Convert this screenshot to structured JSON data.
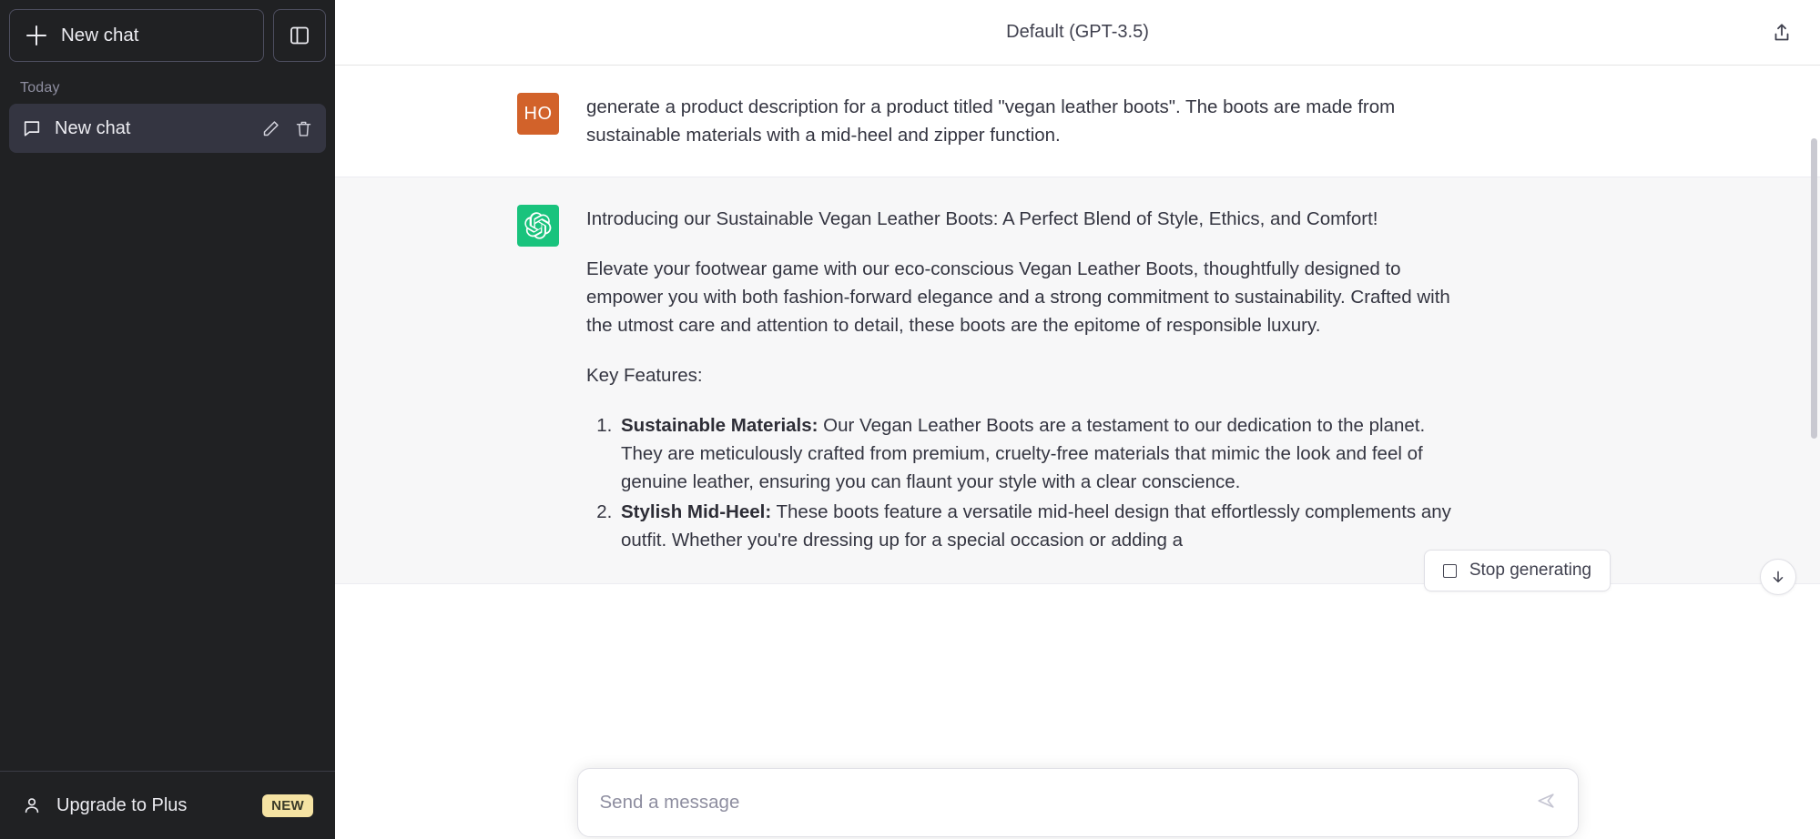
{
  "sidebar": {
    "new_chat_label": "New chat",
    "new_chat_icon": "plus-icon",
    "collapse_icon": "sidebar-collapse-icon",
    "section_label": "Today",
    "chats": [
      {
        "title": "New chat",
        "icon": "chat-bubble-icon",
        "edit_icon": "pencil-icon",
        "delete_icon": "trash-icon",
        "active": true
      }
    ],
    "upgrade": {
      "label": "Upgrade to Plus",
      "icon": "person-icon",
      "badge": "NEW",
      "badge_color": "#f5e3a3"
    }
  },
  "header": {
    "title": "Default (GPT-3.5)",
    "share_icon": "share-upload-icon"
  },
  "messages": [
    {
      "role": "user",
      "avatar_initials": "HO",
      "avatar_color": "#d2622a",
      "paragraphs": [
        "generate a product description for a product titled \"vegan leather boots\". The boots are made from sustainable materials with a mid-heel and zipper function."
      ]
    },
    {
      "role": "assistant",
      "avatar_icon": "chatgpt-logo-icon",
      "avatar_color": "#19c37d",
      "paragraphs": [
        "Introducing our Sustainable Vegan Leather Boots: A Perfect Blend of Style, Ethics, and Comfort!",
        "Elevate your footwear game with our eco-conscious Vegan Leather Boots, thoughtfully designed to empower you with both fashion-forward elegance and a strong commitment to sustainability. Crafted with the utmost care and attention to detail, these boots are the epitome of responsible luxury.",
        "Key Features:"
      ],
      "list": [
        {
          "lead": "Sustainable Materials:",
          "text": " Our Vegan Leather Boots are a testament to our dedication to the planet. They are meticulously crafted from premium, cruelty-free materials that mimic the look and feel of genuine leather, ensuring you can flaunt your style with a clear conscience."
        },
        {
          "lead": "Stylish Mid-Heel:",
          "text": " These boots feature a versatile mid-heel design that effortlessly complements any outfit. Whether you're dressing up for a special occasion or adding a"
        }
      ]
    }
  ],
  "controls": {
    "stop_generating_label": "Stop generating",
    "stop_icon": "stop-square-icon",
    "scroll_down_icon": "arrow-down-icon"
  },
  "composer": {
    "placeholder": "Send a message",
    "send_icon": "send-icon"
  }
}
